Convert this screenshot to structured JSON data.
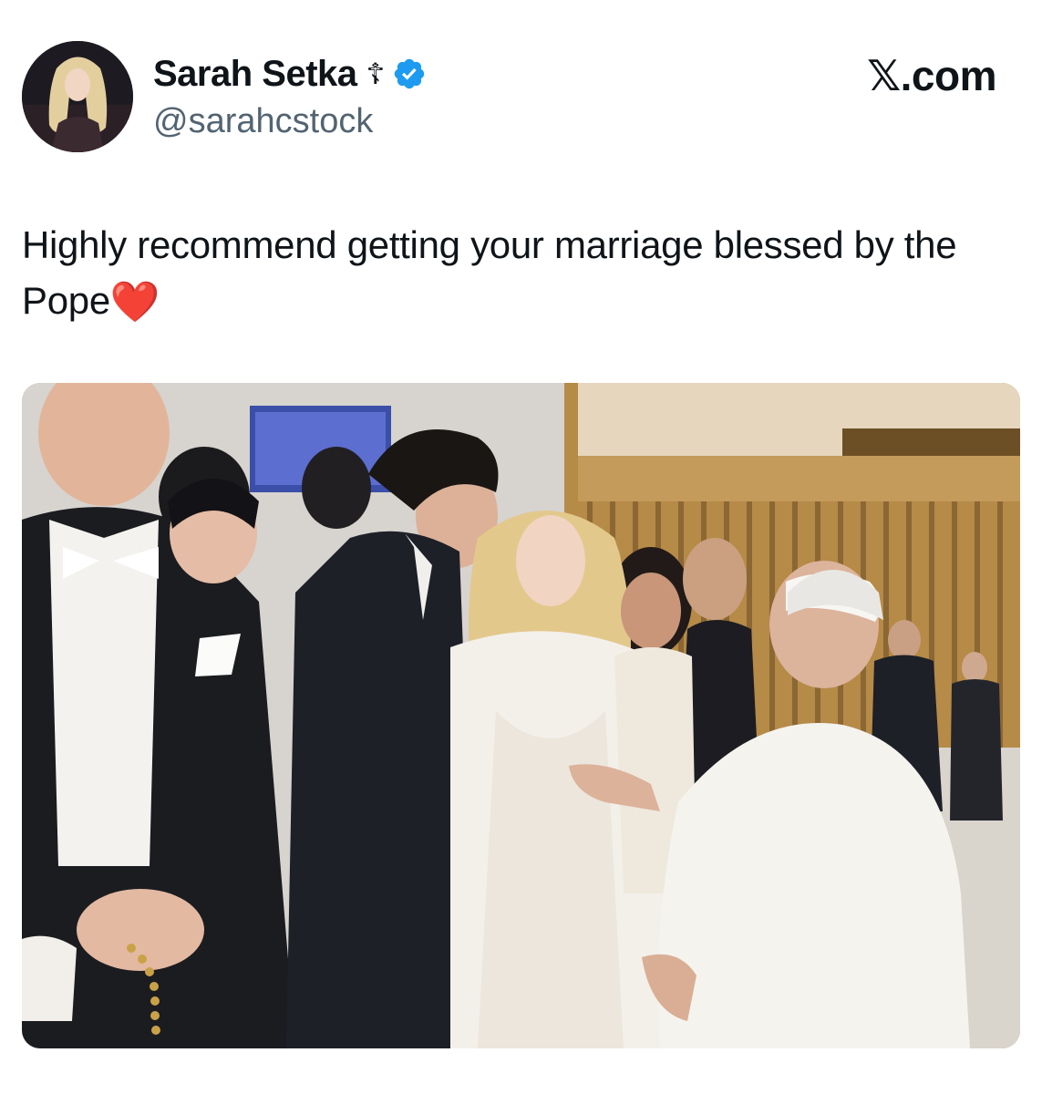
{
  "tweet": {
    "author": {
      "name": "Sarah Setka",
      "name_suffix": "☦",
      "handle": "@sarahcstock",
      "verified": true,
      "verified_color": "#1d9bf0"
    },
    "brand": {
      "mark": "𝕏",
      "domain": ".com"
    },
    "text_main": "Highly recommend getting your marriage blessed by the Pope",
    "text_emoji": "❤️",
    "media": {
      "kind": "photo"
    }
  },
  "colors": {
    "text": "#0f1419",
    "secondary": "#536471",
    "heart": "#e0243a"
  }
}
